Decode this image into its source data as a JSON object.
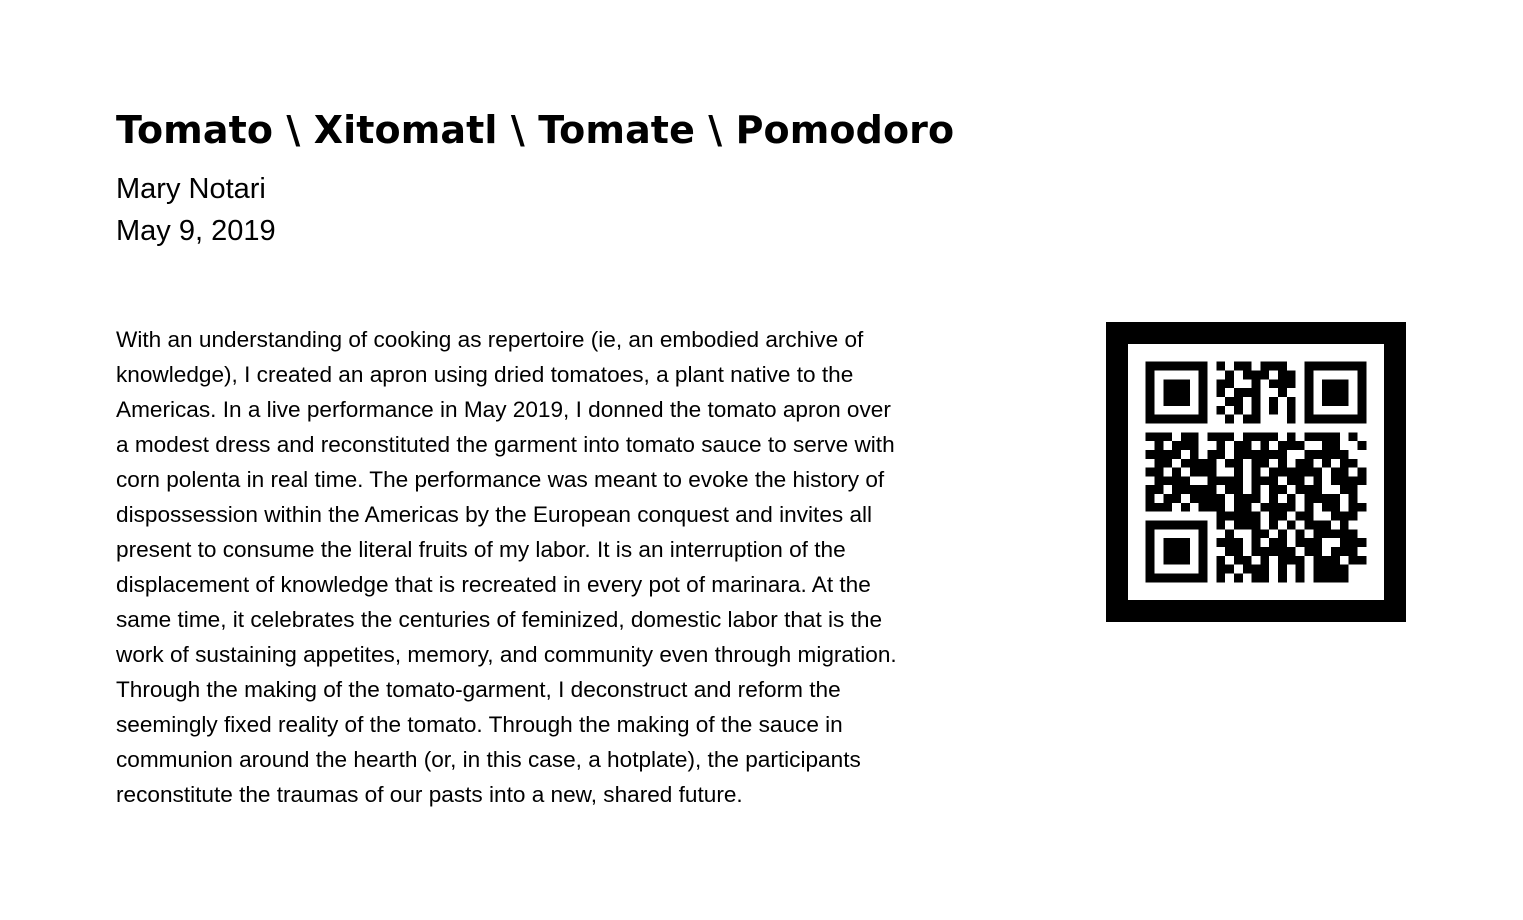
{
  "document": {
    "title": "Tomato \\ Xitomatl \\ Tomate \\ Pomodoro",
    "author": "Mary Notari",
    "date": "May 9, 2019",
    "body": "With an understanding of cooking as repertoire (ie, an embodied archive of\nknowledge), I created an apron using dried tomatoes, a plant native to the\nAmericas. In a live performance in May 2019, I donned the tomato apron over\na modest dress and reconstituted the garment into tomato sauce to serve with\ncorn polenta in real time. The performance was meant to evoke the history of\ndispossession within the Americas by the European conquest and invites all\npresent to consume the literal fruits of my labor. It is an interruption of the\ndisplacement of knowledge that is recreated in every pot of marinara. At the\nsame time, it celebrates the centuries of feminized, domestic labor that is the\nwork of sustaining appetites, memory, and community even through migration.\nThrough the making of the tomato-garment, I deconstruct and reform the\nseemingly fixed reality of the tomato. Through the making of the sauce in\ncommunion around the hearth (or, in this case, a hotplate), the participants\nreconstitute the traumas of our pasts into a new, shared future."
  },
  "qr": {
    "icon": "qr-code-icon",
    "frame_color": "#000000",
    "module_color": "#000000",
    "background_color": "#ffffff"
  }
}
